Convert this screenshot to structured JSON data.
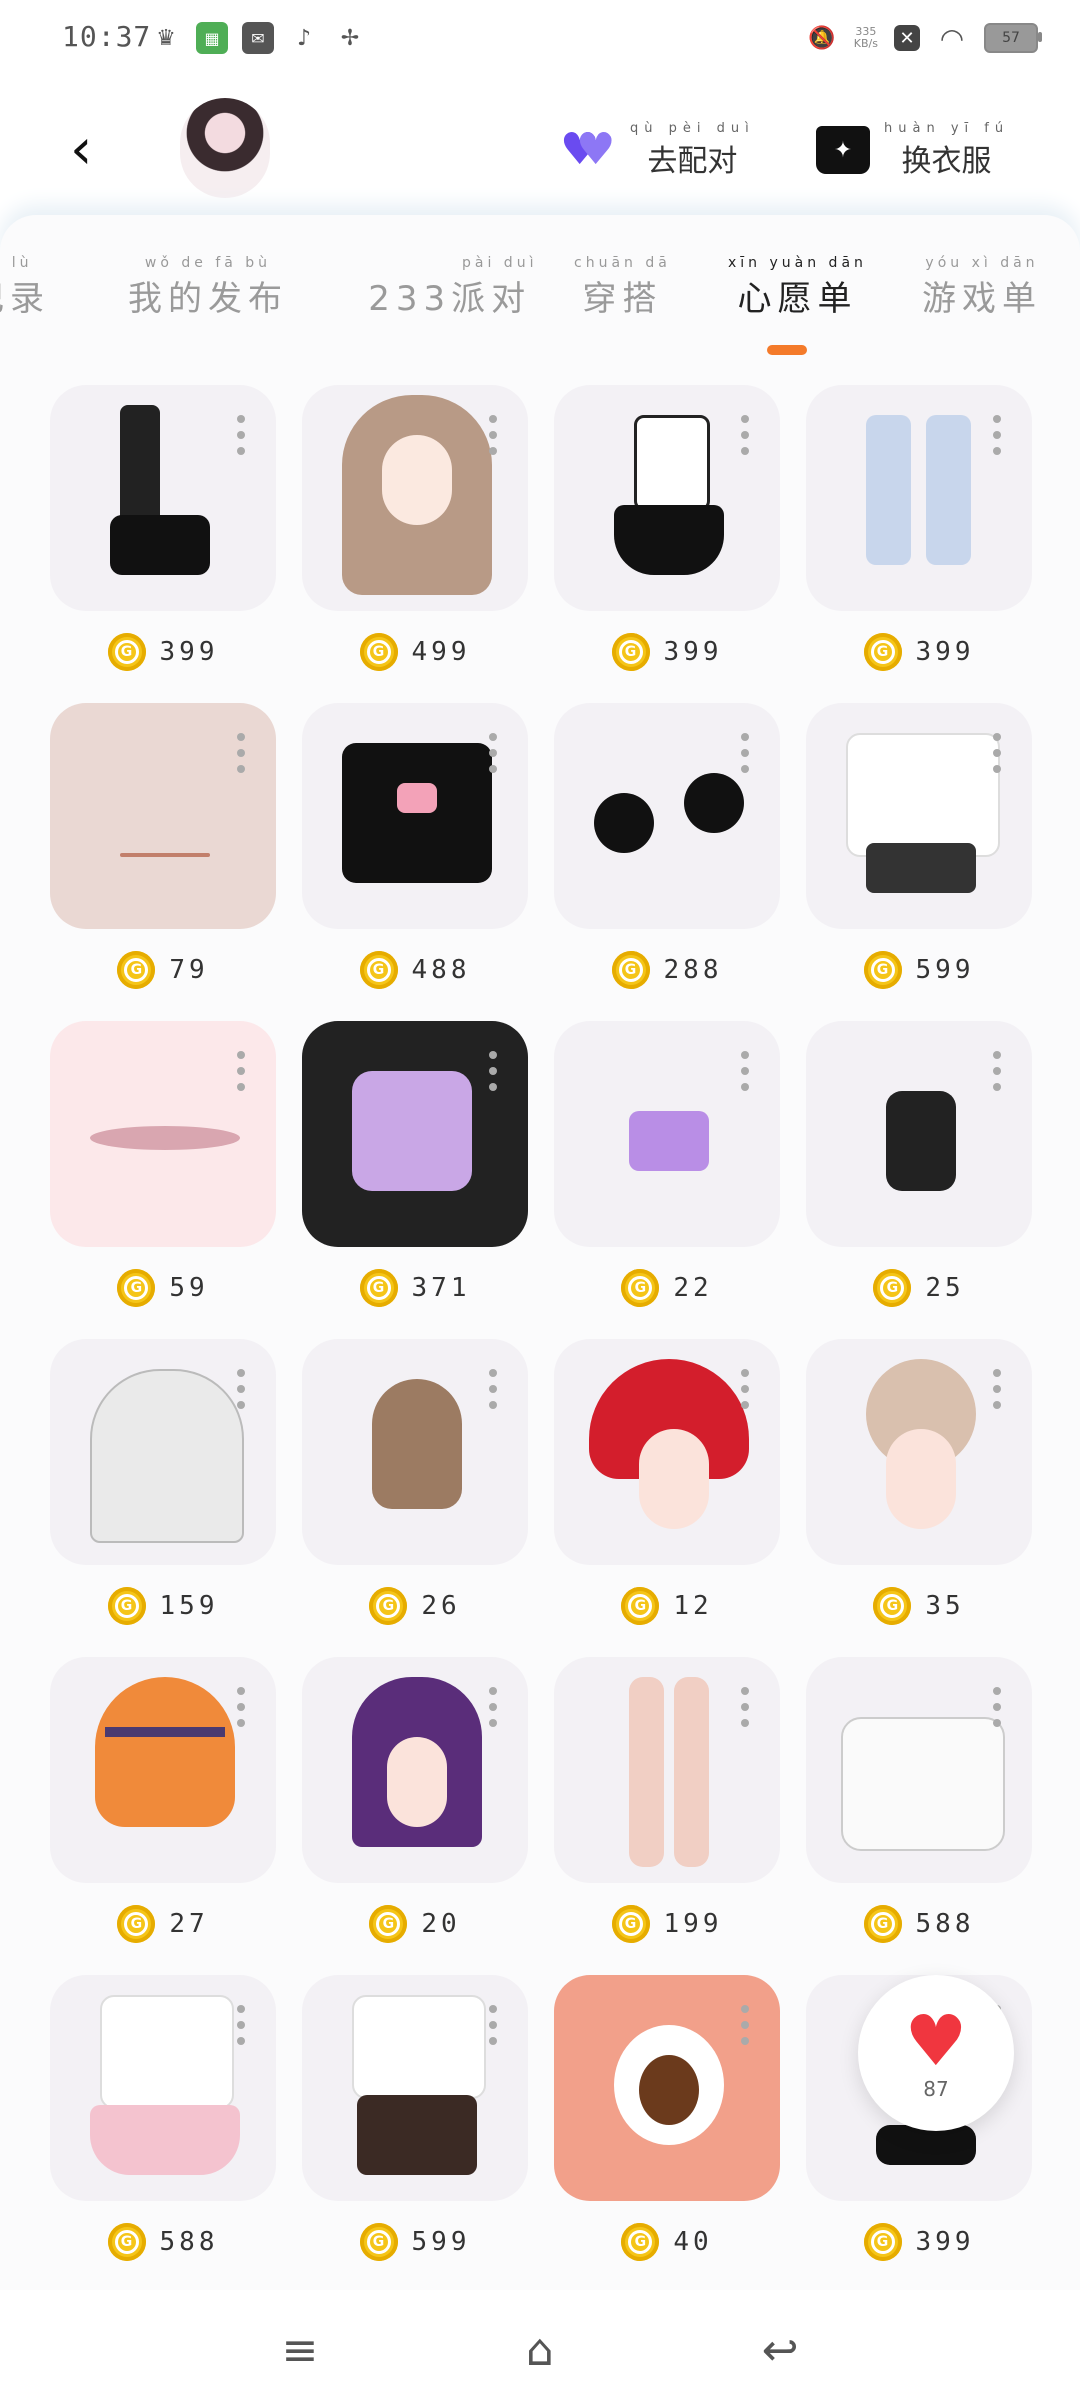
{
  "status": {
    "time": "10:37",
    "net_speed_top": "335",
    "net_speed_bottom": "KB/s",
    "battery": "57"
  },
  "header": {
    "pair_label": "去配对",
    "pair_pinyin": "qù pèi duì",
    "dress_label": "换衣服",
    "dress_pinyin": "huàn yī fú"
  },
  "tabs": [
    {
      "label": "记录",
      "pinyin": "jì lù"
    },
    {
      "label": "我的发布",
      "pinyin": "wǒ de fā bù"
    },
    {
      "label": "233派对",
      "pinyin": "pài duì"
    },
    {
      "label": "穿搭",
      "pinyin": "chuān dā"
    },
    {
      "label": "心愿单",
      "pinyin": "xīn yuàn dān"
    },
    {
      "label": "游戏单",
      "pinyin": "yóu xì dān"
    }
  ],
  "active_tab": "心愿单",
  "items": [
    {
      "name": "black-boots",
      "price": "399"
    },
    {
      "name": "brown-braid-hair",
      "price": "499"
    },
    {
      "name": "maid-dress",
      "price": "399"
    },
    {
      "name": "denim-shorts",
      "price": "399"
    },
    {
      "name": "face-mouth",
      "price": "79"
    },
    {
      "name": "black-tshirt",
      "price": "488"
    },
    {
      "name": "cat-ears",
      "price": "288"
    },
    {
      "name": "white-bow-dress",
      "price": "599"
    },
    {
      "name": "vampire-lips",
      "price": "59"
    },
    {
      "name": "purple-outfit",
      "price": "371"
    },
    {
      "name": "purple-tube-top",
      "price": "22"
    },
    {
      "name": "black-halter-top",
      "price": "25"
    },
    {
      "name": "white-long-hair",
      "price": "159"
    },
    {
      "name": "brown-bob-hair",
      "price": "26"
    },
    {
      "name": "red-bun-hair",
      "price": "12"
    },
    {
      "name": "beige-bun-hair",
      "price": "35"
    },
    {
      "name": "orange-hair-headband",
      "price": "27"
    },
    {
      "name": "purple-horn-hair",
      "price": "20"
    },
    {
      "name": "beige-leggings",
      "price": "199"
    },
    {
      "name": "white-hoodie-cat",
      "price": "588"
    },
    {
      "name": "pink-lace-dress",
      "price": "588"
    },
    {
      "name": "teddy-outfit",
      "price": "599"
    },
    {
      "name": "brown-eye",
      "price": "40"
    },
    {
      "name": "black-shoes",
      "price": "399"
    }
  ],
  "like_count": "87",
  "colors": {
    "accent": "#f47a2a",
    "coin": "#f5c518",
    "heart": "#f0363f",
    "pair_heart": "#6a4bf0"
  }
}
